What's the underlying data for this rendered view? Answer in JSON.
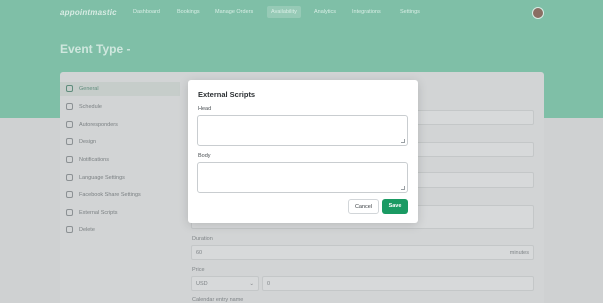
{
  "nav": {
    "logo": "appointmastic",
    "items": [
      {
        "label": "Dashboard"
      },
      {
        "label": "Bookings"
      },
      {
        "label": "Manage Orders"
      },
      {
        "label": "Availability"
      },
      {
        "label": "Analytics"
      },
      {
        "label": "Integrations"
      },
      {
        "label": "Settings"
      }
    ]
  },
  "page": {
    "title": "Event Type -"
  },
  "sidebar": {
    "items": [
      {
        "label": "General",
        "icon": "globe-icon"
      },
      {
        "label": "Schedule",
        "icon": "calendar-icon"
      },
      {
        "label": "Autoresponders",
        "icon": "mail-icon"
      },
      {
        "label": "Design",
        "icon": "palette-icon"
      },
      {
        "label": "Notifications",
        "icon": "bell-icon"
      },
      {
        "label": "Language Settings",
        "icon": "language-icon"
      },
      {
        "label": "Facebook Share Settings",
        "icon": "share-icon"
      },
      {
        "label": "External Scripts",
        "icon": "code-icon"
      },
      {
        "label": "Delete",
        "icon": "trash-icon"
      }
    ]
  },
  "form": {
    "duration_label": "Duration",
    "duration_value": "60",
    "duration_unit": "minutes",
    "price_label": "Price",
    "currency_value": "USD",
    "price_value": "0",
    "bottom_label": "Calendar entry name"
  },
  "modal": {
    "title": "External Scripts",
    "head_label": "Head",
    "head_value": "",
    "body_label": "Body",
    "body_value": "",
    "cancel_label": "Cancel",
    "save_label": "Save"
  },
  "colors": {
    "accent": "#1a9a63",
    "header_bg": "#7fbfa7"
  }
}
